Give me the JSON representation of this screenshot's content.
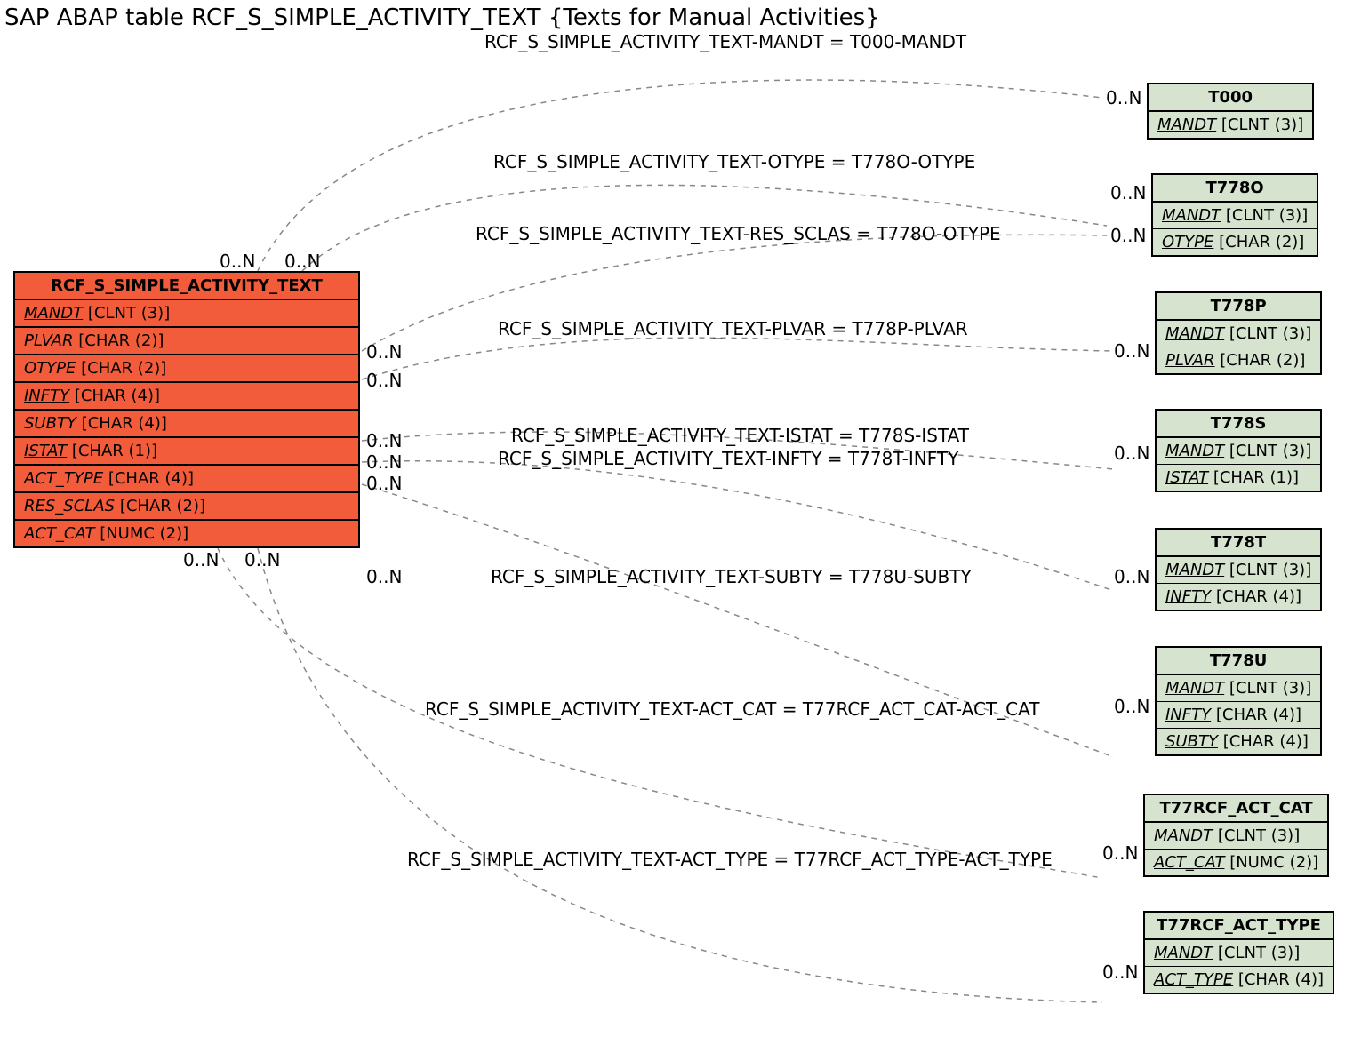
{
  "title": "SAP ABAP table RCF_S_SIMPLE_ACTIVITY_TEXT {Texts for Manual Activities}",
  "subtitle": "RCF_S_SIMPLE_ACTIVITY_TEXT-MANDT = T000-MANDT",
  "main_table": {
    "name": "RCF_S_SIMPLE_ACTIVITY_TEXT",
    "fields": [
      {
        "name": "MANDT",
        "type": "[CLNT (3)]",
        "key": true
      },
      {
        "name": "PLVAR",
        "type": "[CHAR (2)]",
        "key": true
      },
      {
        "name": "OTYPE",
        "type": "[CHAR (2)]",
        "key": false
      },
      {
        "name": "INFTY",
        "type": "[CHAR (4)]",
        "key": true
      },
      {
        "name": "SUBTY",
        "type": "[CHAR (4)]",
        "key": false
      },
      {
        "name": "ISTAT",
        "type": "[CHAR (1)]",
        "key": true
      },
      {
        "name": "ACT_TYPE",
        "type": "[CHAR (4)]",
        "key": false
      },
      {
        "name": "RES_SCLAS",
        "type": "[CHAR (2)]",
        "key": false
      },
      {
        "name": "ACT_CAT",
        "type": "[NUMC (2)]",
        "key": false
      }
    ]
  },
  "ref_tables": [
    {
      "name": "T000",
      "fields": [
        {
          "name": "MANDT",
          "type": "[CLNT (3)]",
          "key": true
        }
      ]
    },
    {
      "name": "T778O",
      "fields": [
        {
          "name": "MANDT",
          "type": "[CLNT (3)]",
          "key": true
        },
        {
          "name": "OTYPE",
          "type": "[CHAR (2)]",
          "key": true
        }
      ]
    },
    {
      "name": "T778P",
      "fields": [
        {
          "name": "MANDT",
          "type": "[CLNT (3)]",
          "key": true
        },
        {
          "name": "PLVAR",
          "type": "[CHAR (2)]",
          "key": true
        }
      ]
    },
    {
      "name": "T778S",
      "fields": [
        {
          "name": "MANDT",
          "type": "[CLNT (3)]",
          "key": true
        },
        {
          "name": "ISTAT",
          "type": "[CHAR (1)]",
          "key": true
        }
      ]
    },
    {
      "name": "T778T",
      "fields": [
        {
          "name": "MANDT",
          "type": "[CLNT (3)]",
          "key": true
        },
        {
          "name": "INFTY",
          "type": "[CHAR (4)]",
          "key": true
        }
      ]
    },
    {
      "name": "T778U",
      "fields": [
        {
          "name": "MANDT",
          "type": "[CLNT (3)]",
          "key": true
        },
        {
          "name": "INFTY",
          "type": "[CHAR (4)]",
          "key": true
        },
        {
          "name": "SUBTY",
          "type": "[CHAR (4)]",
          "key": true
        }
      ]
    },
    {
      "name": "T77RCF_ACT_CAT",
      "fields": [
        {
          "name": "MANDT",
          "type": "[CLNT (3)]",
          "key": true
        },
        {
          "name": "ACT_CAT",
          "type": "[NUMC (2)]",
          "key": true
        }
      ]
    },
    {
      "name": "T77RCF_ACT_TYPE",
      "fields": [
        {
          "name": "MANDT",
          "type": "[CLNT (3)]",
          "key": true
        },
        {
          "name": "ACT_TYPE",
          "type": "[CHAR (4)]",
          "key": true
        }
      ]
    }
  ],
  "relations": [
    "RCF_S_SIMPLE_ACTIVITY_TEXT-OTYPE = T778O-OTYPE",
    "RCF_S_SIMPLE_ACTIVITY_TEXT-RES_SCLAS = T778O-OTYPE",
    "RCF_S_SIMPLE_ACTIVITY_TEXT-PLVAR = T778P-PLVAR",
    "RCF_S_SIMPLE_ACTIVITY_TEXT-ISTAT = T778S-ISTAT",
    "RCF_S_SIMPLE_ACTIVITY_TEXT-INFTY = T778T-INFTY",
    "RCF_S_SIMPLE_ACTIVITY_TEXT-SUBTY = T778U-SUBTY",
    "RCF_S_SIMPLE_ACTIVITY_TEXT-ACT_CAT = T77RCF_ACT_CAT-ACT_CAT",
    "RCF_S_SIMPLE_ACTIVITY_TEXT-ACT_TYPE = T77RCF_ACT_TYPE-ACT_TYPE"
  ],
  "cardinality": "0..N"
}
